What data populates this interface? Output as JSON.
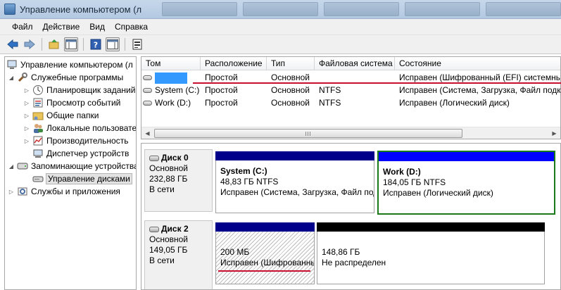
{
  "window": {
    "title": "Управление компьютером (л"
  },
  "menu": [
    "Файл",
    "Действие",
    "Вид",
    "Справка"
  ],
  "tree": {
    "root": "Управление компьютером (л",
    "utilities": "Служебные программы",
    "task_scheduler": "Планировщик заданий",
    "event_viewer": "Просмотр событий",
    "shared_folders": "Общие папки",
    "local_users": "Локальные пользователи",
    "performance": "Производительность",
    "device_manager": "Диспетчер устройств",
    "storage": "Запоминающие устройства",
    "disk_management": "Управление дисками",
    "services": "Службы и приложения"
  },
  "volumes": {
    "columns": [
      "Том",
      "Расположение",
      "Тип",
      "Файловая система",
      "Состояние"
    ],
    "rows": [
      {
        "name": "",
        "layout": "Простой",
        "type": "Основной",
        "fs": "",
        "status": "Исправен (Шифрованный (EFI) системный раздел)"
      },
      {
        "name": "System (C:)",
        "layout": "Простой",
        "type": "Основной",
        "fs": "NTFS",
        "status": "Исправен (Система, Загрузка, Файл подкачки, Аварийный дамп памяти, Основной раздел)"
      },
      {
        "name": "Work (D:)",
        "layout": "Простой",
        "type": "Основной",
        "fs": "NTFS",
        "status": "Исправен (Логический диск)"
      }
    ]
  },
  "disks": [
    {
      "title": "Диск 0",
      "type": "Основной",
      "size": "232,88 ГБ",
      "state": "В сети",
      "partitions": [
        {
          "name": "System  (C:)",
          "size": "48,83 ГБ NTFS",
          "status": "Исправен (Система, Загрузка, Файл подкачки)"
        },
        {
          "name": "Work  (D:)",
          "size": "184,05 ГБ NTFS",
          "status": "Исправен (Логический диск)"
        }
      ]
    },
    {
      "title": "Диск 2",
      "type": "Основной",
      "size": "149,05 ГБ",
      "state": "В сети",
      "partitions": [
        {
          "size": "200 МБ",
          "status": "Исправен (Шифрованный (EFI) системный раздел)"
        },
        {
          "size": "148,86 ГБ",
          "status": "Не распределен"
        }
      ]
    }
  ],
  "colors": {
    "primary_bar": "#00008b",
    "logical_bar": "#0000ff",
    "unallocated_bar": "#000000",
    "selection_border": "#1a7a1a",
    "annotation": "#c8102e"
  }
}
